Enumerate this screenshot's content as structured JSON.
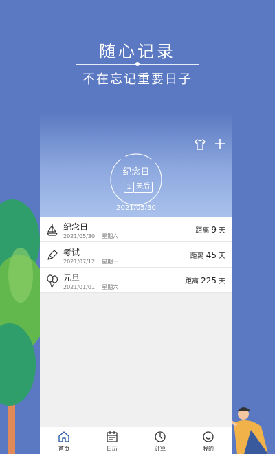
{
  "header": {
    "title": "随心记录",
    "subtitle": "不在忘记重要日子"
  },
  "hero": {
    "event_name": "纪念日",
    "days_number": "1",
    "days_suffix": "天后",
    "date": "2021/05/30"
  },
  "events": [
    {
      "icon": "sailboat-icon",
      "name": "纪念日",
      "date": "2021/05/30",
      "weekday": "星期六",
      "prefix": "距离",
      "days": "9",
      "unit": "天"
    },
    {
      "icon": "pen-icon",
      "name": "考试",
      "date": "2021/07/12",
      "weekday": "星期一",
      "prefix": "距离",
      "days": "45",
      "unit": "天"
    },
    {
      "icon": "balloons-icon",
      "name": "元旦",
      "date": "2021/01/01",
      "weekday": "星期六",
      "prefix": "距离",
      "days": "225",
      "unit": "天"
    }
  ],
  "tabs": [
    {
      "label": "首页",
      "icon": "home-icon",
      "active": true
    },
    {
      "label": "日历",
      "icon": "calendar-icon",
      "active": false
    },
    {
      "label": "计算",
      "icon": "clock-icon",
      "active": false
    },
    {
      "label": "我的",
      "icon": "smiley-icon",
      "active": false
    }
  ],
  "colors": {
    "background": "#5b79c2",
    "accent": "#2f5fa8"
  }
}
